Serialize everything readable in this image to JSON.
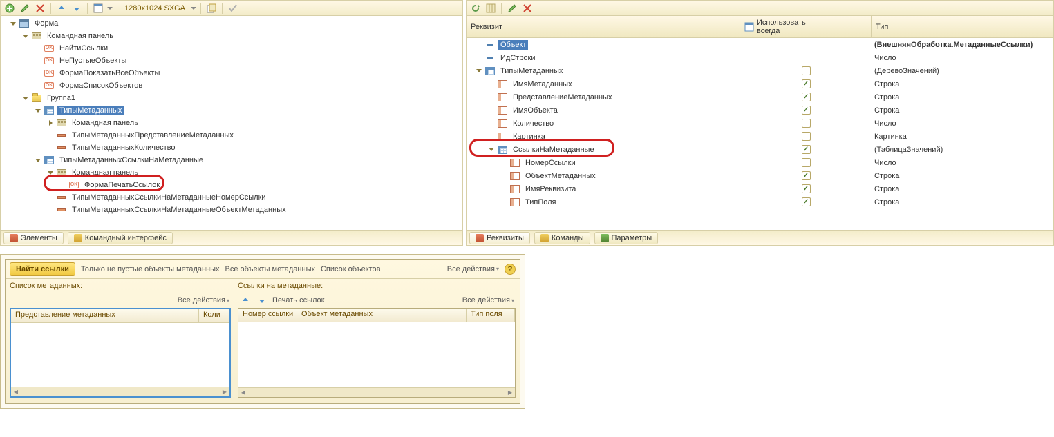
{
  "left": {
    "toolbar": {
      "resolution": "1280x1024 SXGA"
    },
    "tree": [
      {
        "indent": 0,
        "exp": "open",
        "icon": "form",
        "label": "Форма"
      },
      {
        "indent": 1,
        "exp": "open",
        "icon": "cmdpanel",
        "label": "Командная панель"
      },
      {
        "indent": 2,
        "exp": "",
        "icon": "ok",
        "label": "НайтиСсылки"
      },
      {
        "indent": 2,
        "exp": "",
        "icon": "ok",
        "label": "НеПустыеОбъекты"
      },
      {
        "indent": 2,
        "exp": "",
        "icon": "ok",
        "label": "ФормаПоказатьВсеОбъекты"
      },
      {
        "indent": 2,
        "exp": "",
        "icon": "ok",
        "label": "ФормаСписокОбъектов"
      },
      {
        "indent": 1,
        "exp": "open",
        "icon": "folder",
        "label": "Группа1"
      },
      {
        "indent": 2,
        "exp": "open",
        "icon": "table",
        "label": "ТипыМетаданных",
        "selected": true
      },
      {
        "indent": 3,
        "exp": "closed",
        "icon": "cmdpanel",
        "label": "Командная панель"
      },
      {
        "indent": 3,
        "exp": "",
        "icon": "field",
        "label": "ТипыМетаданныхПредставлениеМетаданных"
      },
      {
        "indent": 3,
        "exp": "",
        "icon": "field",
        "label": "ТипыМетаданныхКоличество"
      },
      {
        "indent": 2,
        "exp": "open",
        "icon": "table",
        "label": "ТипыМетаданныхСсылкиНаМетаданные"
      },
      {
        "indent": 3,
        "exp": "open",
        "icon": "cmdpanel",
        "label": "Командная панель"
      },
      {
        "indent": 4,
        "exp": "",
        "icon": "ok",
        "label": "ФормаПечатьСсылок",
        "hl": true
      },
      {
        "indent": 3,
        "exp": "",
        "icon": "field",
        "label": "ТипыМетаданныхСсылкиНаМетаданныеНомерСсылки"
      },
      {
        "indent": 3,
        "exp": "",
        "icon": "field",
        "label": "ТипыМетаданныхСсылкиНаМетаданныеОбъектМетаданных"
      }
    ],
    "tabs": {
      "elements": "Элементы",
      "cmdInterface": "Командный интерфейс"
    }
  },
  "right": {
    "header": {
      "requisite": "Реквизит",
      "useAlways": "Использовать\nвсегда",
      "type": "Тип"
    },
    "rows": [
      {
        "indent": 0,
        "exp": "",
        "icon": "dash",
        "label": "Объект",
        "selected": true,
        "chk": null,
        "type": "(ВнешняяОбработка.МетаданныеСсылки)",
        "bold": true
      },
      {
        "indent": 0,
        "exp": "",
        "icon": "dash",
        "label": "ИдСтроки",
        "chk": null,
        "type": "Число"
      },
      {
        "indent": 0,
        "exp": "open",
        "icon": "table",
        "label": "ТипыМетаданных",
        "chk": false,
        "type": "(ДеревоЗначений)"
      },
      {
        "indent": 1,
        "exp": "",
        "icon": "column",
        "label": "ИмяМетаданных",
        "chk": true,
        "type": "Строка"
      },
      {
        "indent": 1,
        "exp": "",
        "icon": "column",
        "label": "ПредставлениеМетаданных",
        "chk": true,
        "type": "Строка"
      },
      {
        "indent": 1,
        "exp": "",
        "icon": "column",
        "label": "ИмяОбъекта",
        "chk": true,
        "type": "Строка"
      },
      {
        "indent": 1,
        "exp": "",
        "icon": "column",
        "label": "Количество",
        "chk": false,
        "type": "Число"
      },
      {
        "indent": 1,
        "exp": "",
        "icon": "column",
        "label": "Картинка",
        "chk": false,
        "type": "Картинка"
      },
      {
        "indent": 1,
        "exp": "open",
        "icon": "table",
        "label": "СсылкиНаМетаданные",
        "chk": true,
        "type": "(ТаблицаЗначений)",
        "hl": true
      },
      {
        "indent": 2,
        "exp": "",
        "icon": "column",
        "label": "НомерСсылки",
        "chk": false,
        "type": "Число"
      },
      {
        "indent": 2,
        "exp": "",
        "icon": "column",
        "label": "ОбъектМетаданных",
        "chk": true,
        "type": "Строка"
      },
      {
        "indent": 2,
        "exp": "",
        "icon": "column",
        "label": "ИмяРеквизита",
        "chk": true,
        "type": "Строка"
      },
      {
        "indent": 2,
        "exp": "",
        "icon": "column",
        "label": "ТипПоля",
        "chk": true,
        "type": "Строка"
      }
    ],
    "tabs": {
      "requisites": "Реквизиты",
      "commands": "Команды",
      "parameters": "Параметры"
    }
  },
  "preview": {
    "toolbar": {
      "find": "Найти ссылки",
      "nonEmpty": "Только не пустые объекты метаданных",
      "allObjects": "Все объекты метаданных",
      "objectList": "Список объектов",
      "allActions": "Все действия"
    },
    "left": {
      "title": "Список метаданных:",
      "allActions": "Все действия",
      "cols": {
        "c1": "Представление метаданных",
        "c2": "Коли"
      }
    },
    "right": {
      "title": "Ссылки на метаданные:",
      "print": "Печать ссылок",
      "allActions": "Все действия",
      "cols": {
        "c1": "Номер ссылки",
        "c2": "Объект метаданных",
        "c3": "Тип поля"
      }
    }
  }
}
